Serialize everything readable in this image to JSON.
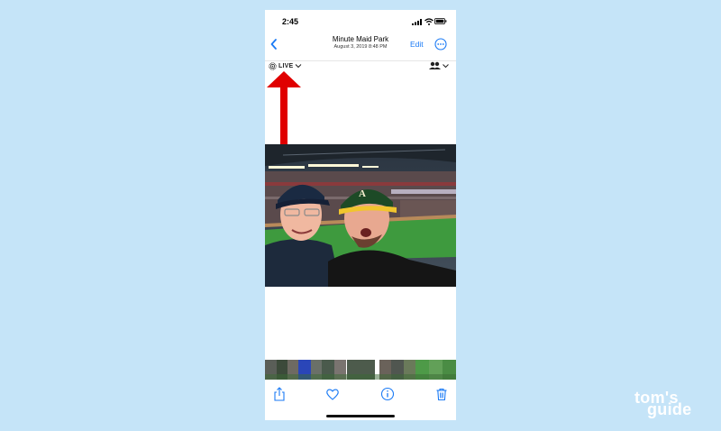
{
  "status_bar": {
    "time": "2:45"
  },
  "nav": {
    "back_icon": "chevron-left-icon",
    "title": "Minute Maid Park",
    "subtitle": "August 3, 2019  8:48 PM",
    "edit_label": "Edit",
    "more_icon": "ellipsis-circle-icon"
  },
  "photo_controls": {
    "live_label": "LIVE",
    "people_icon": "people-icon"
  },
  "toolbar": {
    "icons": [
      "share-icon",
      "heart-icon",
      "info-icon",
      "trash-icon"
    ]
  },
  "watermark": {
    "line1": "tom's",
    "line2": "guide"
  },
  "colors": {
    "background": "#c5e4f8",
    "accent": "#1a7af5",
    "annotation_arrow": "#e00000"
  }
}
